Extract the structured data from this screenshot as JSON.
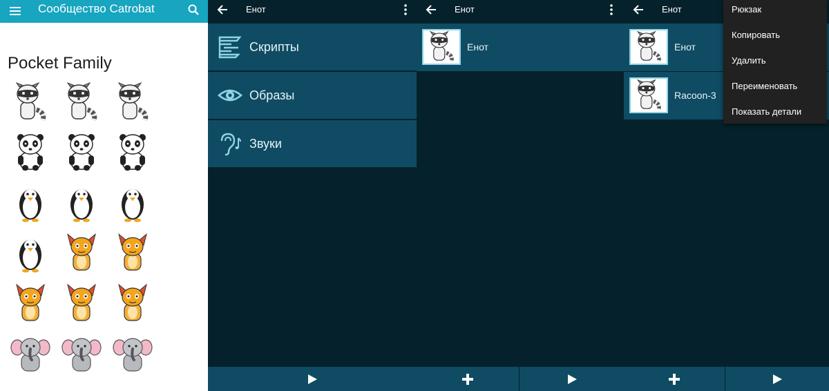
{
  "panel1": {
    "title": "Сообщество Catrobat",
    "section_title": "Pocket Family",
    "grid": [
      "raccoon",
      "raccoon",
      "raccoon",
      "panda",
      "panda",
      "panda",
      "penguin",
      "penguin",
      "penguin",
      "penguin",
      "fox",
      "fox",
      "fox",
      "fox",
      "fox",
      "elephant",
      "elephant",
      "elephant"
    ]
  },
  "panel2": {
    "title": "Енот",
    "items": [
      {
        "label": "Скрипты",
        "icon": "scripts-icon"
      },
      {
        "label": "Образы",
        "icon": "eye-icon"
      },
      {
        "label": "Звуки",
        "icon": "ear-music-icon"
      }
    ]
  },
  "panel3": {
    "title": "Енот",
    "items": [
      {
        "label": "Енот"
      }
    ]
  },
  "panel4": {
    "title": "Енот",
    "items": [
      {
        "label": "Енот"
      },
      {
        "label": "Racoon-3"
      }
    ],
    "context_menu": [
      "Рюкзак",
      "Копировать",
      "Удалить",
      "Переименовать",
      "Показать детали"
    ]
  },
  "colors": {
    "accent": "#17a5c0",
    "dark_bg": "#05222c",
    "item_bg": "#0f4c63",
    "menu_bg": "#212121"
  }
}
